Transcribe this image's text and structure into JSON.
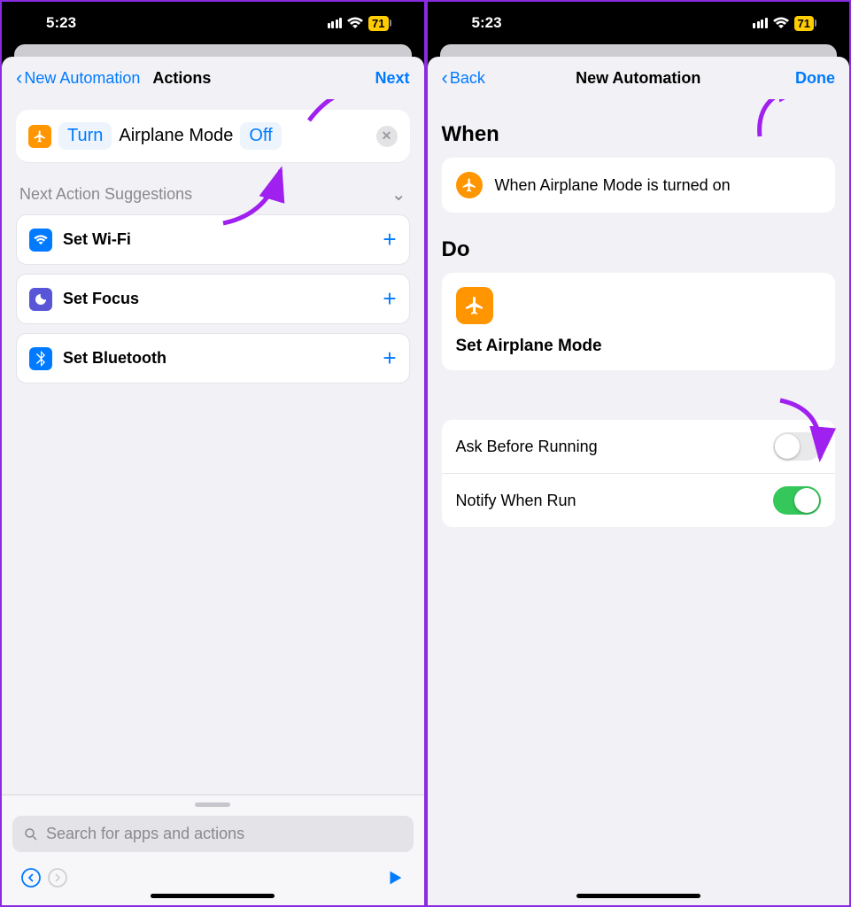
{
  "status": {
    "time": "5:23",
    "battery": "71"
  },
  "left": {
    "nav": {
      "back": "New Automation",
      "title": "Actions",
      "next": "Next"
    },
    "action": {
      "turn": "Turn",
      "subject": "Airplane Mode",
      "state": "Off"
    },
    "suggestions_header": "Next Action Suggestions",
    "suggestions": [
      {
        "label": "Set Wi-Fi"
      },
      {
        "label": "Set Focus"
      },
      {
        "label": "Set Bluetooth"
      }
    ],
    "search_placeholder": "Search for apps and actions"
  },
  "right": {
    "nav": {
      "back": "Back",
      "title": "New Automation",
      "done": "Done"
    },
    "when_header": "When",
    "when_text": "When Airplane Mode is turned on",
    "do_header": "Do",
    "do_label": "Set Airplane Mode",
    "toggles": {
      "ask_label": "Ask Before Running",
      "ask_on": false,
      "notify_label": "Notify When Run",
      "notify_on": true
    }
  }
}
